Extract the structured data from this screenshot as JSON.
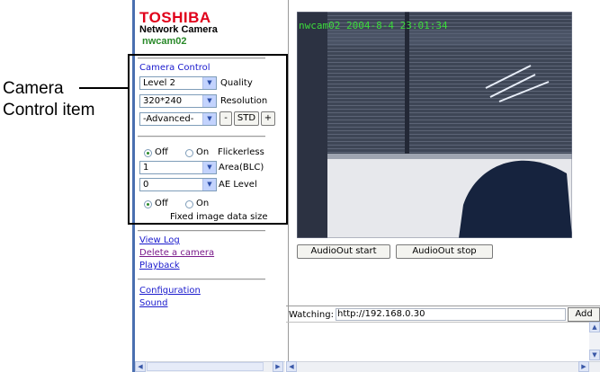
{
  "callout": {
    "line1": "Camera",
    "line2": "Control item"
  },
  "brand": {
    "name": "TOSHIBA",
    "subtitle": "Network Camera",
    "camera_name": "nwcam02"
  },
  "camera_control": {
    "title": "Camera Control",
    "quality": {
      "value": "Level 2",
      "label": "Quality"
    },
    "resolution": {
      "value": "320*240",
      "label": "Resolution"
    },
    "advanced": {
      "value": "-Advanced-",
      "minus": "-",
      "std": "STD",
      "plus": "+"
    },
    "flickerless": {
      "off": "Off",
      "on": "On",
      "label": "Flickerless",
      "selected": "Off"
    },
    "area_blc": {
      "value": "1",
      "label": "Area(BLC)"
    },
    "ae_level": {
      "value": "0",
      "label": "AE Level"
    },
    "fixed_size": {
      "off": "Off",
      "on": "On",
      "label": "Fixed image data size",
      "selected": "Off"
    }
  },
  "links": {
    "view_log": "View Log",
    "delete_camera": "Delete a camera",
    "playback": "Playback",
    "configuration": "Configuration",
    "sound": "Sound"
  },
  "video": {
    "overlay": "nwcam02  2004-8-4  23:01:34"
  },
  "audio": {
    "start": "AudioOut start",
    "stop": "AudioOut stop"
  },
  "watching": {
    "label": "Watching:",
    "url": "http://192.168.0.30",
    "add": "Add"
  }
}
